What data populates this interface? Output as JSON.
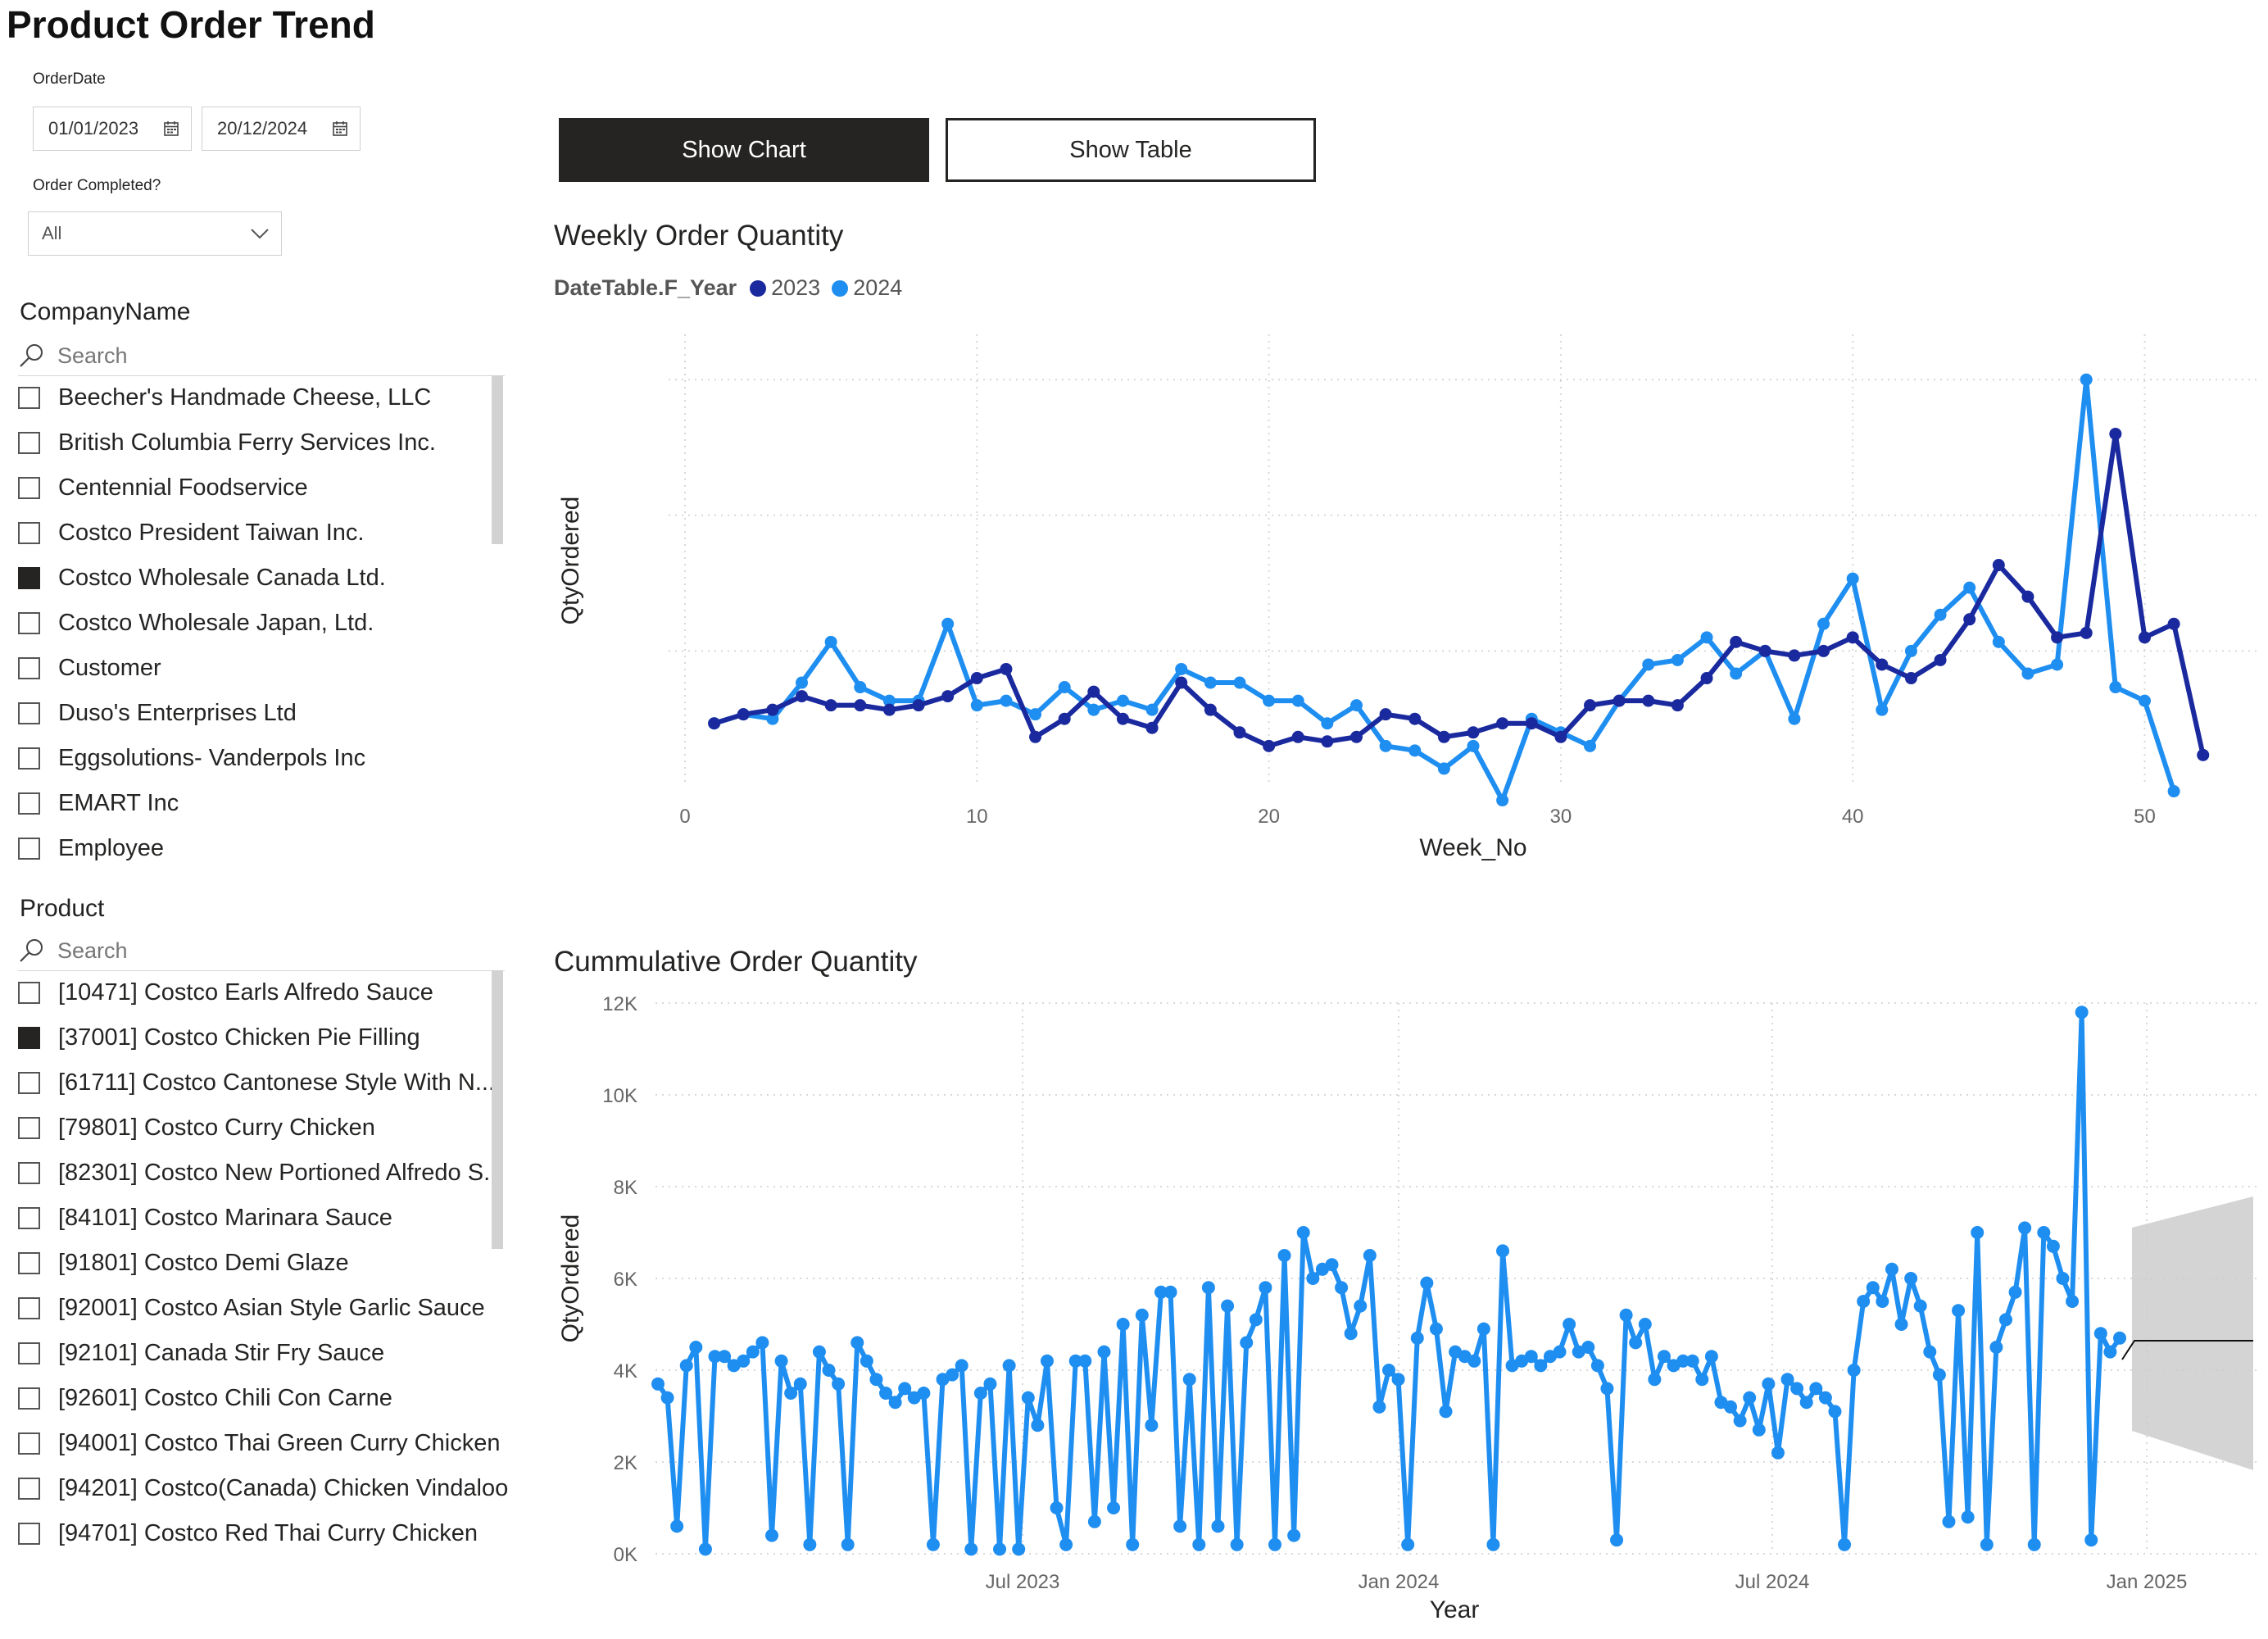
{
  "page": {
    "title": "Product Order Trend"
  },
  "filters": {
    "order_date": {
      "label": "OrderDate",
      "start": "01/01/2023",
      "end": "20/12/2024"
    },
    "order_completed": {
      "label": "Order Completed?",
      "value": "All"
    }
  },
  "company_slicer": {
    "title": "CompanyName",
    "search_placeholder": "Search",
    "items": [
      {
        "label": "Beecher's Handmade Cheese, LLC",
        "checked": false
      },
      {
        "label": "British Columbia Ferry Services Inc.",
        "checked": false
      },
      {
        "label": "Centennial Foodservice",
        "checked": false
      },
      {
        "label": "Costco President Taiwan Inc.",
        "checked": false
      },
      {
        "label": "Costco Wholesale Canada Ltd.",
        "checked": true
      },
      {
        "label": "Costco Wholesale Japan, Ltd.",
        "checked": false
      },
      {
        "label": "Customer",
        "checked": false
      },
      {
        "label": "Duso's Enterprises Ltd",
        "checked": false
      },
      {
        "label": "Eggsolutions- Vanderpols Inc",
        "checked": false
      },
      {
        "label": "EMART Inc",
        "checked": false
      },
      {
        "label": "Employee",
        "checked": false
      }
    ]
  },
  "product_slicer": {
    "title": "Product",
    "search_placeholder": "Search",
    "items": [
      {
        "label": "[10471] Costco Earls Alfredo Sauce",
        "checked": false
      },
      {
        "label": "[37001] Costco Chicken Pie Filling",
        "checked": true
      },
      {
        "label": "[61711] Costco Cantonese Style With N...",
        "checked": false
      },
      {
        "label": "[79801] Costco Curry Chicken",
        "checked": false
      },
      {
        "label": "[82301] Costco New Portioned Alfredo S...",
        "checked": false
      },
      {
        "label": "[84101] Costco Marinara Sauce",
        "checked": false
      },
      {
        "label": "[91801] Costco Demi Glaze",
        "checked": false
      },
      {
        "label": "[92001] Costco Asian Style Garlic Sauce",
        "checked": false
      },
      {
        "label": "[92101] Canada Stir Fry Sauce",
        "checked": false
      },
      {
        "label": "[92601] Costco Chili Con Carne",
        "checked": false
      },
      {
        "label": "[94001] Costco Thai Green Curry Chicken",
        "checked": false
      },
      {
        "label": "[94201] Costco(Canada) Chicken Vindaloo",
        "checked": false
      },
      {
        "label": "[94701] Costco Red Thai Curry Chicken",
        "checked": false
      }
    ]
  },
  "buttons": {
    "show_chart": "Show Chart",
    "show_table": "Show Table"
  },
  "colors": {
    "series_2023": "#1a2a9e",
    "series_2024": "#1f8ef1",
    "dark": "#252423"
  },
  "chart_data": [
    {
      "type": "line",
      "title": "Weekly Order Quantity",
      "xlabel": "Week_No",
      "ylabel": "QtyOrdered",
      "legend_title": "DateTable.F_Year",
      "xlim": [
        0,
        54
      ],
      "xticks": [
        0,
        10,
        20,
        30,
        40,
        50
      ],
      "ylim": [
        0,
        100
      ],
      "grid": true,
      "legend_position": "top-left",
      "series": [
        {
          "name": "2023",
          "x": [
            1,
            2,
            3,
            4,
            5,
            6,
            7,
            8,
            9,
            10,
            11,
            12,
            13,
            14,
            15,
            16,
            17,
            18,
            19,
            20,
            21,
            22,
            23,
            24,
            25,
            26,
            27,
            28,
            29,
            30,
            31,
            32,
            33,
            34,
            35,
            36,
            37,
            38,
            39,
            40,
            41,
            42,
            43,
            44,
            45,
            46,
            47,
            48,
            49,
            50,
            51,
            52
          ],
          "y": [
            14,
            16,
            17,
            20,
            18,
            18,
            17,
            18,
            20,
            24,
            26,
            11,
            15,
            21,
            15,
            13,
            23,
            17,
            12,
            9,
            11,
            10,
            11,
            16,
            15,
            11,
            12,
            14,
            14,
            11,
            18,
            19,
            19,
            18,
            24,
            32,
            30,
            29,
            30,
            33,
            27,
            24,
            28,
            37,
            49,
            42,
            33,
            34,
            78,
            33,
            36,
            7
          ]
        },
        {
          "name": "2024",
          "x": [
            1,
            2,
            3,
            4,
            5,
            6,
            7,
            8,
            9,
            10,
            11,
            12,
            13,
            14,
            15,
            16,
            17,
            18,
            19,
            20,
            21,
            22,
            23,
            24,
            25,
            26,
            27,
            28,
            29,
            30,
            31,
            32,
            33,
            34,
            35,
            36,
            37,
            38,
            39,
            40,
            41,
            42,
            43,
            44,
            45,
            46,
            47,
            48,
            49,
            50,
            51
          ],
          "y": [
            14,
            16,
            15,
            23,
            32,
            22,
            19,
            19,
            36,
            18,
            19,
            16,
            22,
            17,
            19,
            17,
            26,
            23,
            23,
            19,
            19,
            14,
            18,
            9,
            8,
            4,
            9,
            -3,
            15,
            12,
            9,
            19,
            27,
            28,
            33,
            25,
            30,
            15,
            36,
            46,
            17,
            30,
            38,
            44,
            32,
            25,
            27,
            90,
            22,
            19,
            -1
          ]
        }
      ]
    },
    {
      "type": "line",
      "title": "Cummulative Order Quantity",
      "xlabel": "Year",
      "ylabel": "QtyOrdered",
      "x_tick_labels": [
        "Jul 2023",
        "Jan 2024",
        "Jul 2024",
        "Jan 2025"
      ],
      "y_tick_labels": [
        "0K",
        "2K",
        "4K",
        "6K",
        "8K",
        "10K",
        "12K"
      ],
      "ylim": [
        0,
        12000
      ],
      "grid": true,
      "series": [
        {
          "name": "",
          "y": [
            3700,
            3400,
            600,
            4100,
            4500,
            100,
            4300,
            4300,
            4100,
            4200,
            4400,
            4600,
            400,
            4200,
            3500,
            3700,
            200,
            4400,
            4000,
            3700,
            200,
            4600,
            4200,
            3800,
            3500,
            3300,
            3600,
            3400,
            3500,
            200,
            3800,
            3900,
            4100,
            100,
            3500,
            3700,
            100,
            4100,
            100,
            3400,
            2800,
            4200,
            1000,
            200,
            4200,
            4200,
            700,
            4400,
            1000,
            5000,
            200,
            5200,
            2800,
            5700,
            5700,
            600,
            3800,
            200,
            5800,
            600,
            5400,
            200,
            4600,
            5100,
            5800,
            200,
            6500,
            400,
            7000,
            6000,
            6200,
            6300,
            5800,
            4800,
            5400,
            6500,
            3200,
            4000,
            3800,
            200,
            4700,
            5900,
            4900,
            3100,
            4400,
            4300,
            4200,
            4900,
            200,
            6600,
            4100,
            4200,
            4300,
            4100,
            4300,
            4400,
            5000,
            4400,
            4500,
            4100,
            3600,
            300,
            5200,
            4600,
            5000,
            3800,
            4300,
            4100,
            4200,
            4200,
            3800,
            4300,
            3300,
            3200,
            2900,
            3400,
            2700,
            3700,
            2200,
            3800,
            3600,
            3300,
            3600,
            3400,
            3100,
            200,
            4000,
            5500,
            5800,
            5500,
            6200,
            5000,
            6000,
            5400,
            4400,
            3900,
            700,
            5300,
            800,
            7000,
            200,
            4500,
            5100,
            5700,
            7100,
            200,
            7000,
            6700,
            6000,
            5500,
            11800,
            300,
            4800,
            4400,
            4700
          ]
        }
      ]
    }
  ]
}
